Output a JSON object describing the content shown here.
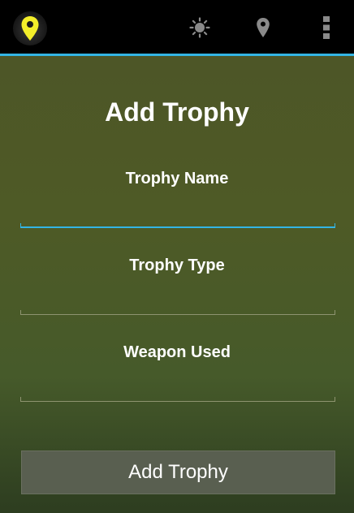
{
  "action_bar": {
    "app_icon": "map-pin-icon",
    "actions": [
      "brightness-icon",
      "location-pin-icon",
      "overflow-menu-icon"
    ],
    "accent_color": "#33b5e5"
  },
  "form": {
    "title": "Add Trophy",
    "fields": [
      {
        "label": "Trophy Name",
        "value": "",
        "focused": true
      },
      {
        "label": "Trophy Type",
        "value": "",
        "focused": false
      },
      {
        "label": "Weapon Used",
        "value": "",
        "focused": false
      }
    ],
    "submit_label": "Add Trophy"
  }
}
